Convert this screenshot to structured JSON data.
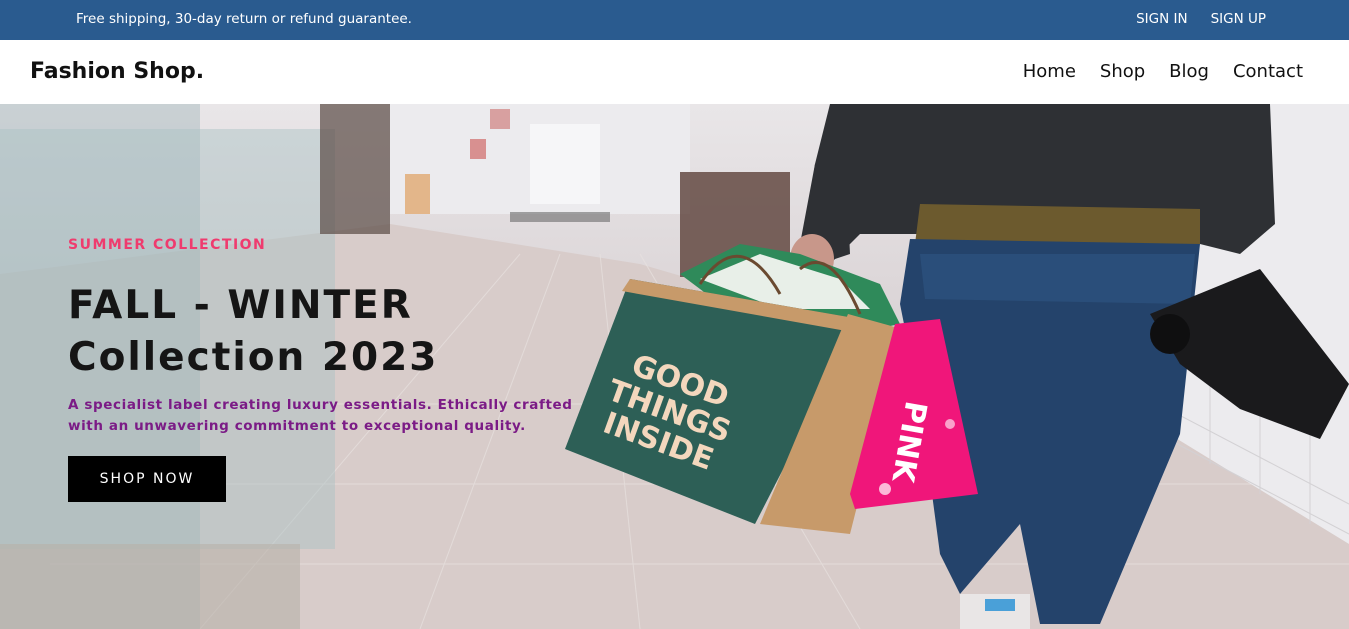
{
  "topbar": {
    "notice": "Free shipping, 30-day return or refund guarantee.",
    "sign_in": "SIGN IN",
    "sign_up": "SIGN UP"
  },
  "navbar": {
    "logo": "Fashion Shop.",
    "menu": [
      "Home",
      "Shop",
      "Blog",
      "Contact"
    ]
  },
  "hero": {
    "eyebrow": "SUMMER COLLECTION",
    "title_line1": "FALL - WINTER",
    "title_line2": "Collection 2023",
    "tagline_line1": "A specialist label creating luxury essentials. Ethically crafted",
    "tagline_line2": "with an unwavering commitment to exceptional quality.",
    "cta": "SHOP NOW",
    "bag_text": [
      "GOOD",
      "THINGS",
      "INSIDE"
    ],
    "pink_bag_text": "PINK"
  },
  "colors": {
    "topbar_bg": "#2a5b8f",
    "accent_pink": "#ef3b6e",
    "tagline_purple": "#7b1b86",
    "button_bg": "#000000"
  }
}
